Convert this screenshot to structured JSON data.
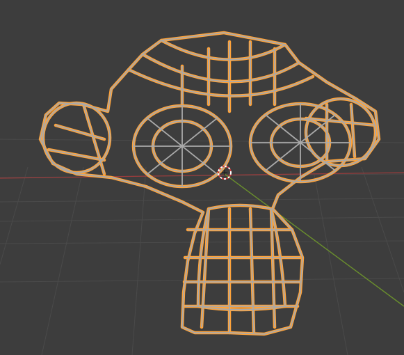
{
  "viewport": {
    "background_color": "#3d3d3d",
    "grid_color": "#4a4a4a",
    "x_axis_color": "#9a3c3c",
    "y_axis_color": "#6a8f2d"
  },
  "object": {
    "type": "mesh",
    "display": "wireframe",
    "shape": "monkey-head",
    "selected": true,
    "wire_color": "#a9a9a9",
    "selection_outline_color": "#ffa33a"
  },
  "cursor_3d": {
    "icon": "3d-cursor-icon",
    "ring_colors": [
      "#ffffff",
      "#cc3b3b"
    ]
  }
}
